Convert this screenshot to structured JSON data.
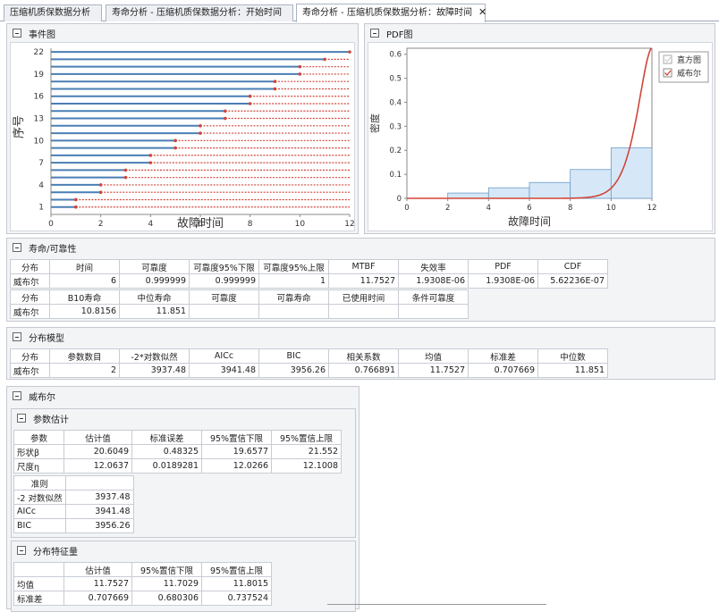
{
  "tabs": [
    {
      "label": "压缩机质保数据分析"
    },
    {
      "label": "寿命分析 - 压缩机质保数据分析：开始时间"
    },
    {
      "label": "寿命分析 - 压缩机质保数据分析：故障时间"
    }
  ],
  "event_panel": {
    "title": "事件图"
  },
  "pdf_panel": {
    "title": "PDF图"
  },
  "legend": {
    "histogram": "直方图",
    "weibull": "威布尔"
  },
  "colors": {
    "bar": "#4a7eb5",
    "red": "#d0453a",
    "hist_fill": "#d6e8f8",
    "hist_edge": "#6d9ac8"
  },
  "chart_data": [
    {
      "type": "event",
      "xlabel": "故障时间",
      "ylabel": "序号",
      "xlim": [
        0,
        12
      ],
      "xticks": [
        0,
        2,
        4,
        6,
        8,
        10,
        12
      ],
      "yticks": [
        1,
        4,
        7,
        10,
        13,
        16,
        19,
        22
      ],
      "ylim": [
        0,
        22.5
      ],
      "events": [
        {
          "index": 1,
          "value": 1
        },
        {
          "index": 2,
          "value": 1
        },
        {
          "index": 3,
          "value": 2
        },
        {
          "index": 4,
          "value": 2
        },
        {
          "index": 5,
          "value": 3
        },
        {
          "index": 6,
          "value": 3
        },
        {
          "index": 7,
          "value": 4
        },
        {
          "index": 8,
          "value": 4
        },
        {
          "index": 9,
          "value": 5
        },
        {
          "index": 10,
          "value": 5
        },
        {
          "index": 11,
          "value": 6
        },
        {
          "index": 12,
          "value": 6
        },
        {
          "index": 13,
          "value": 7
        },
        {
          "index": 14,
          "value": 7
        },
        {
          "index": 15,
          "value": 8
        },
        {
          "index": 16,
          "value": 8
        },
        {
          "index": 17,
          "value": 9
        },
        {
          "index": 18,
          "value": 9
        },
        {
          "index": 19,
          "value": 10
        },
        {
          "index": 20,
          "value": 10
        },
        {
          "index": 21,
          "value": 11
        },
        {
          "index": 22,
          "value": 12
        }
      ]
    },
    {
      "type": "area",
      "xlabel": "故障时间",
      "ylabel": "密度",
      "xlim": [
        0,
        12
      ],
      "ylim": [
        0,
        0.625
      ],
      "xticks": [
        0,
        2,
        4,
        6,
        8,
        10,
        12
      ],
      "yticks": [
        0,
        0.1,
        0.2,
        0.3,
        0.4,
        0.5,
        0.6
      ],
      "histogram": [
        {
          "x0": 0,
          "x1": 2,
          "value": 0
        },
        {
          "x0": 2,
          "x1": 4,
          "value": 0.022
        },
        {
          "x0": 4,
          "x1": 6,
          "value": 0.044
        },
        {
          "x0": 6,
          "x1": 8,
          "value": 0.066
        },
        {
          "x0": 8,
          "x1": 10,
          "value": 0.12
        },
        {
          "x0": 10,
          "x1": 12,
          "value": 0.21
        }
      ],
      "weibull": {
        "shape": 20.6049,
        "scale": 12.0637
      }
    }
  ],
  "reliability": {
    "title": "寿命/可靠性",
    "row1_headers": [
      "分布",
      "时间",
      "可靠度",
      "可靠度95%下限",
      "可靠度95%上限",
      "MTBF",
      "失效率",
      "PDF",
      "CDF"
    ],
    "row1_values": [
      "威布尔",
      "6",
      "0.999999",
      "0.999999",
      "1",
      "11.7527",
      "1.9308E-06",
      "1.9308E-06",
      "5.62236E-07"
    ],
    "row2_headers": [
      "分布",
      "B10寿命",
      "中位寿命",
      "可靠度",
      "可靠寿命",
      "已使用时间",
      "条件可靠度"
    ],
    "row2_values": [
      "威布尔",
      "10.8156",
      "11.851",
      "",
      "",
      "",
      ""
    ]
  },
  "dist_model": {
    "title": "分布模型",
    "headers": [
      "分布",
      "参数数目",
      "-2*对数似然",
      "AICc",
      "BIC",
      "相关系数",
      "均值",
      "标准差",
      "中位数"
    ],
    "values": [
      "威布尔",
      "2",
      "3937.48",
      "3941.48",
      "3956.26",
      "0.766891",
      "11.7527",
      "0.707669",
      "11.851"
    ]
  },
  "weibull_section": {
    "title": "威布尔"
  },
  "param_est": {
    "title": "参数估计",
    "headers": [
      "参数",
      "估计值",
      "标准误差",
      "95%置信下限",
      "95%置信上限"
    ],
    "rows": [
      [
        "形状β",
        "20.6049",
        "0.48325",
        "19.6577",
        "21.552"
      ],
      [
        "尺度η",
        "12.0637",
        "0.0189281",
        "12.0266",
        "12.1008"
      ]
    ],
    "criteria_header": "准则",
    "criteria": [
      [
        "-2 对数似然",
        "3937.48"
      ],
      [
        "AICc",
        "3941.48"
      ],
      [
        "BIC",
        "3956.26"
      ]
    ]
  },
  "dist_char": {
    "title": "分布特征量",
    "headers": [
      "",
      "估计值",
      "95%置信下限",
      "95%置信上限"
    ],
    "rows": [
      [
        "均值",
        "11.7527",
        "11.7029",
        "11.8015"
      ],
      [
        "标准差",
        "0.707669",
        "0.680306",
        "0.737524"
      ]
    ]
  }
}
